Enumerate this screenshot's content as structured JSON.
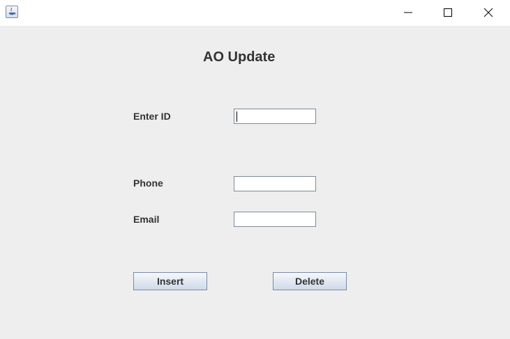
{
  "window": {
    "heading": "AO Update"
  },
  "form": {
    "fields": [
      {
        "label": "Enter ID",
        "value": ""
      },
      {
        "label": "Phone",
        "value": ""
      },
      {
        "label": "Email",
        "value": ""
      }
    ],
    "buttons": {
      "insert": "Insert",
      "delete": "Delete"
    }
  },
  "icons": {
    "app": "java-app-icon",
    "minimize": "minimize-icon",
    "maximize": "maximize-icon",
    "close": "close-icon"
  },
  "colors": {
    "background": "#eeeeee",
    "titlebar": "#ffffff",
    "text": "#333333",
    "button_border": "#7a8aa6"
  }
}
